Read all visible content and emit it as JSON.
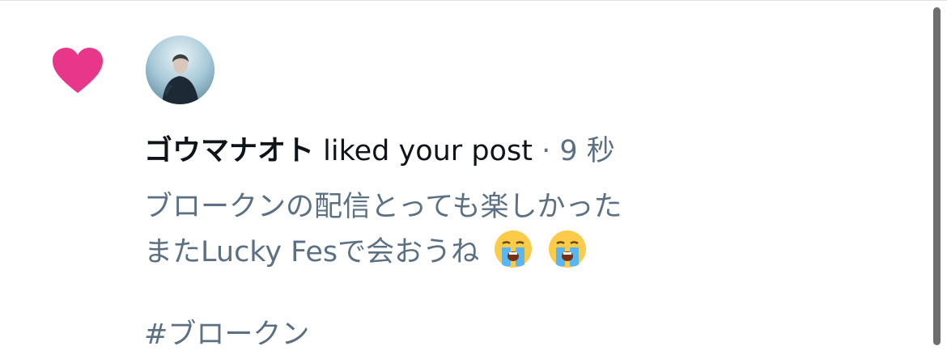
{
  "notification": {
    "type_icon": "heart-icon",
    "avatar": "user-avatar",
    "user_name": "ゴウマナオト",
    "action": "liked your post",
    "separator": "·",
    "time": "9 秒",
    "post_lines": [
      "ブロークンの配信とっても楽しかった",
      "またLucky Fesで会おうね"
    ],
    "emojis": [
      "loudly-crying-face",
      "loudly-crying-face"
    ],
    "hashtag": "#ブロークン"
  },
  "colors": {
    "heart": "#e8378a",
    "primary_text": "#0f1419",
    "secondary_text": "#5b7083",
    "scrollbar": "#6e6e6e"
  }
}
